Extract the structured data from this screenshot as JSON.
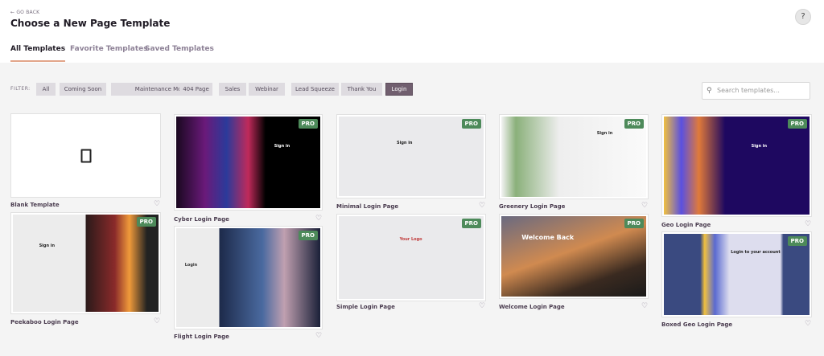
{
  "header": {
    "go_back": "← GO BACK",
    "title": "Choose a New Page Template",
    "help_icon": "?"
  },
  "tabs": [
    {
      "label": "All Templates",
      "active": true
    },
    {
      "label": "Favorite Templates"
    },
    {
      "label": "Saved Templates"
    }
  ],
  "filter": {
    "label": "FILTER:",
    "chips": [
      "All",
      "Coming Soon",
      "Maintenance Mode",
      "404 Page",
      "Sales",
      "Webinar",
      "Lead Squeeze",
      "Thank You",
      "Login"
    ],
    "active": "Login"
  },
  "search": {
    "placeholder": "Search templates..."
  },
  "pro_badge": "PRO",
  "templates": [
    {
      "name": "Blank Template",
      "pro": false
    },
    {
      "name": "Peekaboo Login Page",
      "pro": true,
      "preview_text": "Sign in"
    },
    {
      "name": "Cyber Login Page",
      "pro": true,
      "preview_text": "Sign in"
    },
    {
      "name": "Flight Login Page",
      "pro": true,
      "preview_text": "Login"
    },
    {
      "name": "Minimal Login Page",
      "pro": true,
      "preview_text": "Sign in"
    },
    {
      "name": "Simple Login Page",
      "pro": true,
      "preview_text": "Your Logo"
    },
    {
      "name": "Greenery Login Page",
      "pro": true,
      "preview_text": "Sign in"
    },
    {
      "name": "Welcome Login Page",
      "pro": true,
      "preview_text": "Welcome Back"
    },
    {
      "name": "Geo Login Page",
      "pro": true,
      "preview_text": "Sign in"
    },
    {
      "name": "Boxed Geo Login Page",
      "pro": true,
      "preview_text": "Login to your account"
    }
  ],
  "colors": {
    "accent": "#715f6f",
    "pro": "#4d8a5a",
    "tab_underline": "#e2a58a"
  }
}
